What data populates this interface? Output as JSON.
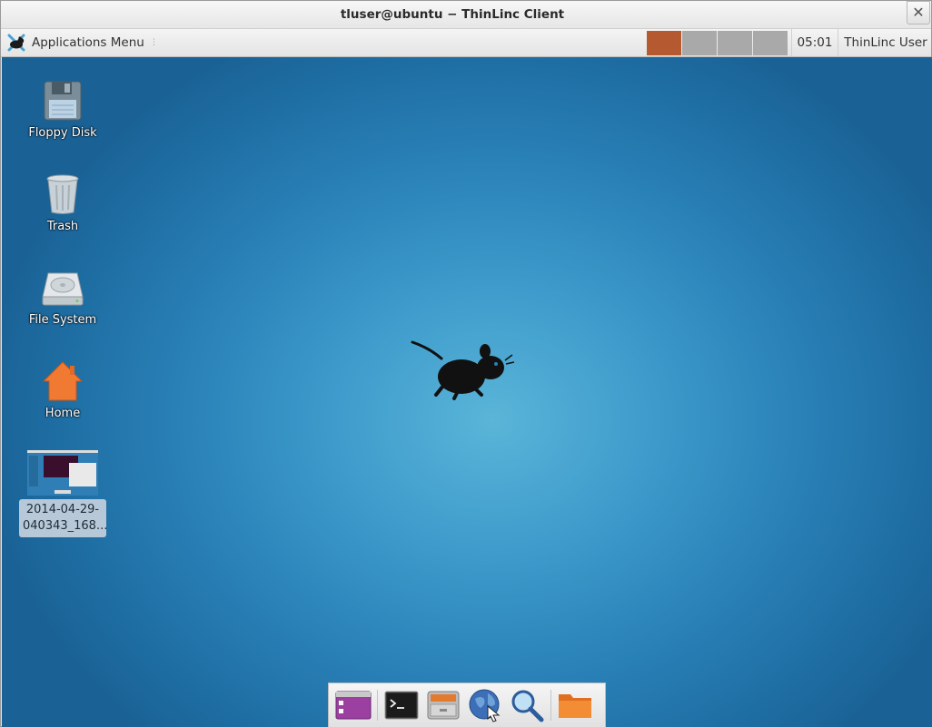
{
  "window": {
    "title": "tluser@ubuntu − ThinLinc Client",
    "close_glyph": "✕"
  },
  "panel": {
    "app_menu_label": "Applications Menu",
    "workspaces": [
      {
        "active": true
      },
      {
        "active": false
      },
      {
        "active": false
      },
      {
        "active": false
      }
    ],
    "clock": "05:01",
    "user": "ThinLinc User",
    "accent_color": "#b55a30"
  },
  "desktop": {
    "icons": [
      {
        "label": "Floppy Disk",
        "icon": "floppy-disk-icon"
      },
      {
        "label": "Trash",
        "icon": "trash-icon"
      },
      {
        "label": "File System",
        "icon": "hard-drive-icon"
      },
      {
        "label": "Home",
        "icon": "home-icon"
      },
      {
        "label": "2014-04-29-040343_168...",
        "icon": "screenshot-thumbnail",
        "selected": true
      }
    ]
  },
  "dock": {
    "items": [
      "show-desktop-icon",
      "terminal-icon",
      "file-manager-icon",
      "web-browser-icon",
      "app-finder-icon",
      "folder-icon"
    ]
  }
}
